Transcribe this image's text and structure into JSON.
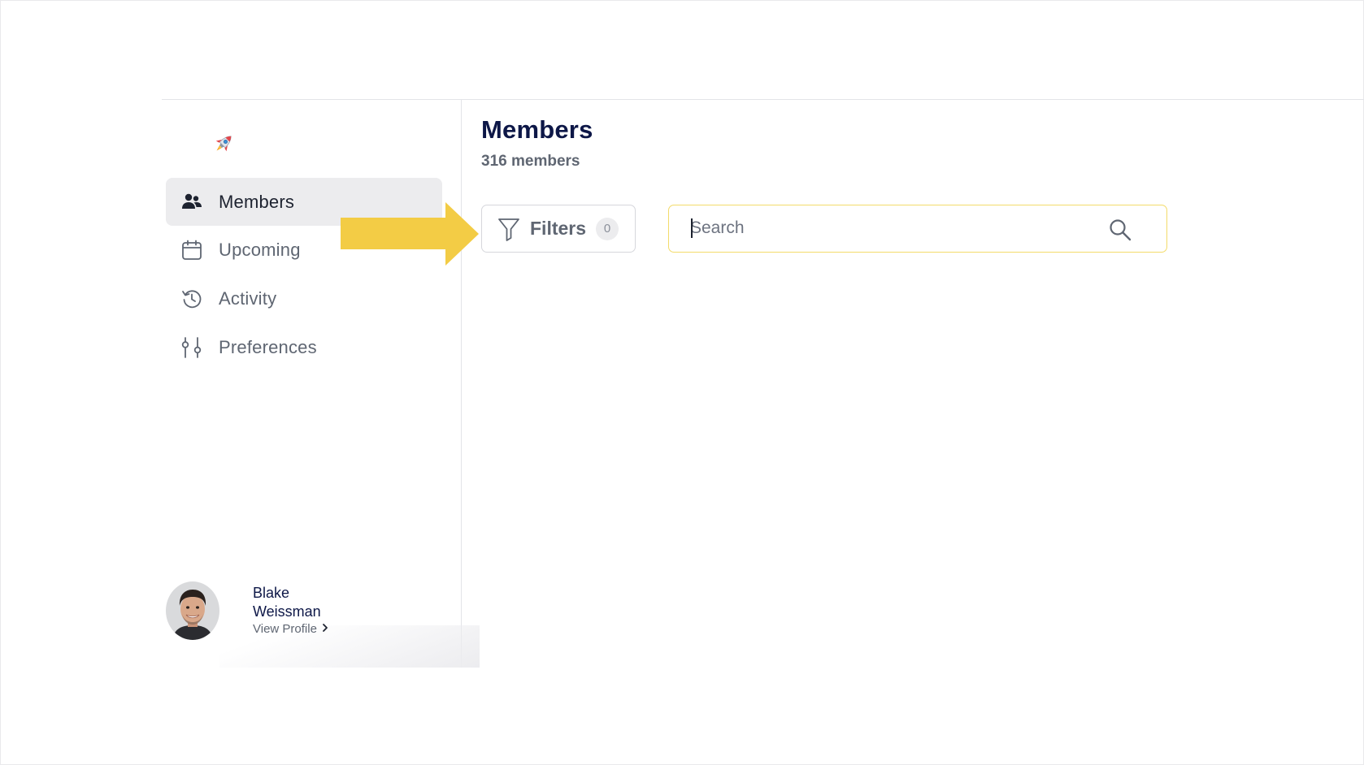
{
  "sidebar": {
    "logo_icon": "rocket-icon",
    "items": [
      {
        "label": "Members",
        "icon": "members-icon",
        "active": true
      },
      {
        "label": "Upcoming",
        "icon": "calendar-icon",
        "active": false
      },
      {
        "label": "Activity",
        "icon": "history-icon",
        "active": false
      },
      {
        "label": "Preferences",
        "icon": "sliders-icon",
        "active": false
      }
    ],
    "profile": {
      "name": "Blake Weissman",
      "link_label": "View Profile"
    }
  },
  "main": {
    "title": "Members",
    "subtitle": "316 members",
    "filters": {
      "label": "Filters",
      "count": "0"
    },
    "search": {
      "placeholder": "Search",
      "value": ""
    }
  },
  "colors": {
    "accent_yellow": "#f3cc45",
    "active_nav_bg": "#ececee",
    "title_navy": "#0d1747",
    "muted_text": "#5f6672"
  }
}
